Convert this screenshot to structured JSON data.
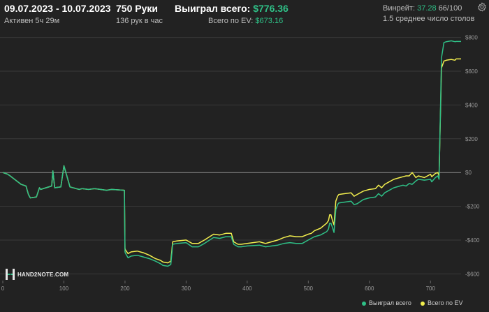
{
  "header": {
    "date_range": "09.07.2023 - 10.07.2023",
    "active": "Активен 5ч 29м",
    "hands": "750 Руки",
    "hands_per_hour": "136 рук в час",
    "won_total_label": "Выиграл всего:",
    "won_total_value": "$776.36",
    "ev_total_label": "Всего по EV:",
    "ev_total_value": "$673.16",
    "winrate_label": "Винрейт:",
    "winrate_value": "37.28",
    "winrate_suffix": "66/100",
    "tables": "1.5 среднее число столов"
  },
  "logo": {
    "text": "HAND2NOTE.COM"
  },
  "legend": {
    "won": "Выиграл всего",
    "ev": "Всего по EV"
  },
  "colors": {
    "won": "#2fc087",
    "ev": "#f2ee4e",
    "background": "#222222",
    "grid": "#3a3a3a",
    "zero_line": "#8c8c8c"
  },
  "icons": {
    "settings": "gear-icon"
  },
  "chart_data": {
    "type": "line",
    "xlabel": "",
    "ylabel": "",
    "xlim": [
      0,
      750
    ],
    "ylim": [
      -640,
      840
    ],
    "x_ticks": [
      0,
      100,
      200,
      300,
      400,
      500,
      600,
      700
    ],
    "y_ticks": [
      800,
      600,
      400,
      200,
      0,
      -200,
      -400,
      -600
    ],
    "y_tick_labels": [
      "$800",
      "$600",
      "$400",
      "$200",
      "$0",
      "-$200",
      "-$400",
      "-$600"
    ],
    "grid": true,
    "legend_position": "bottom-right",
    "series": [
      {
        "name": "Выиграл всего",
        "color": "#2fc087",
        "x": [
          0,
          8,
          12,
          30,
          38,
          42,
          45,
          55,
          60,
          62,
          80,
          82,
          85,
          95,
          100,
          110,
          125,
          130,
          140,
          150,
          160,
          170,
          178,
          199,
          200,
          201,
          205,
          210,
          220,
          230,
          240,
          250,
          258,
          262,
          270,
          275,
          278,
          285,
          300,
          310,
          320,
          330,
          345,
          355,
          365,
          374,
          378,
          385,
          390,
          400,
          420,
          425,
          430,
          440,
          450,
          460,
          470,
          480,
          490,
          500,
          505,
          510,
          520,
          530,
          533,
          535,
          537,
          540,
          542,
          545,
          548,
          550,
          560,
          570,
          575,
          580,
          590,
          600,
          610,
          615,
          620,
          625,
          630,
          640,
          650,
          655,
          660,
          665,
          670,
          676,
          680,
          690,
          700,
          702,
          708,
          712,
          714,
          718,
          722,
          726,
          734,
          740,
          742,
          750
        ],
        "y": [
          0,
          -10,
          -20,
          -70,
          -80,
          -130,
          -150,
          -145,
          -90,
          -100,
          -80,
          10,
          -90,
          -85,
          40,
          -85,
          -100,
          -95,
          -100,
          -95,
          -100,
          -105,
          -100,
          -105,
          -470,
          -480,
          -505,
          -495,
          -490,
          -500,
          -510,
          -525,
          -540,
          -550,
          -555,
          -545,
          -425,
          -420,
          -415,
          -440,
          -440,
          -420,
          -385,
          -390,
          -380,
          -380,
          -425,
          -440,
          -440,
          -435,
          -430,
          -435,
          -440,
          -435,
          -430,
          -420,
          -415,
          -420,
          -420,
          -400,
          -390,
          -380,
          -370,
          -350,
          -335,
          -300,
          -300,
          -330,
          -355,
          -220,
          -190,
          -180,
          -175,
          -170,
          -190,
          -185,
          -160,
          -150,
          -145,
          -125,
          -140,
          -120,
          -110,
          -90,
          -80,
          -75,
          -80,
          -65,
          -70,
          -50,
          -40,
          -45,
          -40,
          -55,
          -30,
          -20,
          -40,
          680,
          770,
          775,
          780,
          775,
          776.36,
          776.36
        ]
      },
      {
        "name": "Всего по EV",
        "color": "#f2ee4e",
        "x": [
          0,
          8,
          12,
          30,
          38,
          42,
          45,
          55,
          60,
          62,
          80,
          82,
          85,
          95,
          100,
          110,
          125,
          130,
          140,
          150,
          160,
          170,
          178,
          199,
          200,
          201,
          205,
          210,
          220,
          230,
          240,
          250,
          258,
          262,
          270,
          275,
          278,
          285,
          300,
          310,
          320,
          330,
          345,
          355,
          365,
          374,
          378,
          385,
          390,
          400,
          420,
          425,
          430,
          440,
          450,
          460,
          470,
          480,
          490,
          500,
          505,
          510,
          520,
          530,
          533,
          535,
          537,
          540,
          542,
          545,
          548,
          550,
          560,
          570,
          575,
          580,
          590,
          600,
          610,
          615,
          620,
          625,
          630,
          640,
          650,
          655,
          660,
          665,
          670,
          676,
          680,
          690,
          700,
          702,
          708,
          712,
          714,
          718,
          722,
          726,
          734,
          740,
          742,
          750
        ],
        "y": [
          0,
          -10,
          -20,
          -70,
          -80,
          -130,
          -150,
          -145,
          -90,
          -100,
          -80,
          10,
          -90,
          -85,
          40,
          -85,
          -100,
          -95,
          -100,
          -95,
          -100,
          -105,
          -100,
          -105,
          -450,
          -460,
          -480,
          -470,
          -465,
          -475,
          -490,
          -510,
          -520,
          -530,
          -535,
          -525,
          -410,
          -405,
          -400,
          -420,
          -420,
          -400,
          -365,
          -370,
          -360,
          -360,
          -410,
          -425,
          -425,
          -420,
          -410,
          -415,
          -420,
          -410,
          -400,
          -385,
          -375,
          -380,
          -380,
          -365,
          -360,
          -345,
          -330,
          -300,
          -285,
          -250,
          -250,
          -290,
          -310,
          -170,
          -140,
          -130,
          -125,
          -120,
          -140,
          -130,
          -110,
          -100,
          -95,
          -75,
          -90,
          -70,
          -60,
          -40,
          -30,
          -25,
          -20,
          -20,
          0,
          -30,
          -20,
          -30,
          -10,
          -25,
          -5,
          0,
          -20,
          620,
          660,
          665,
          670,
          665,
          673.16,
          673.16
        ]
      }
    ]
  }
}
